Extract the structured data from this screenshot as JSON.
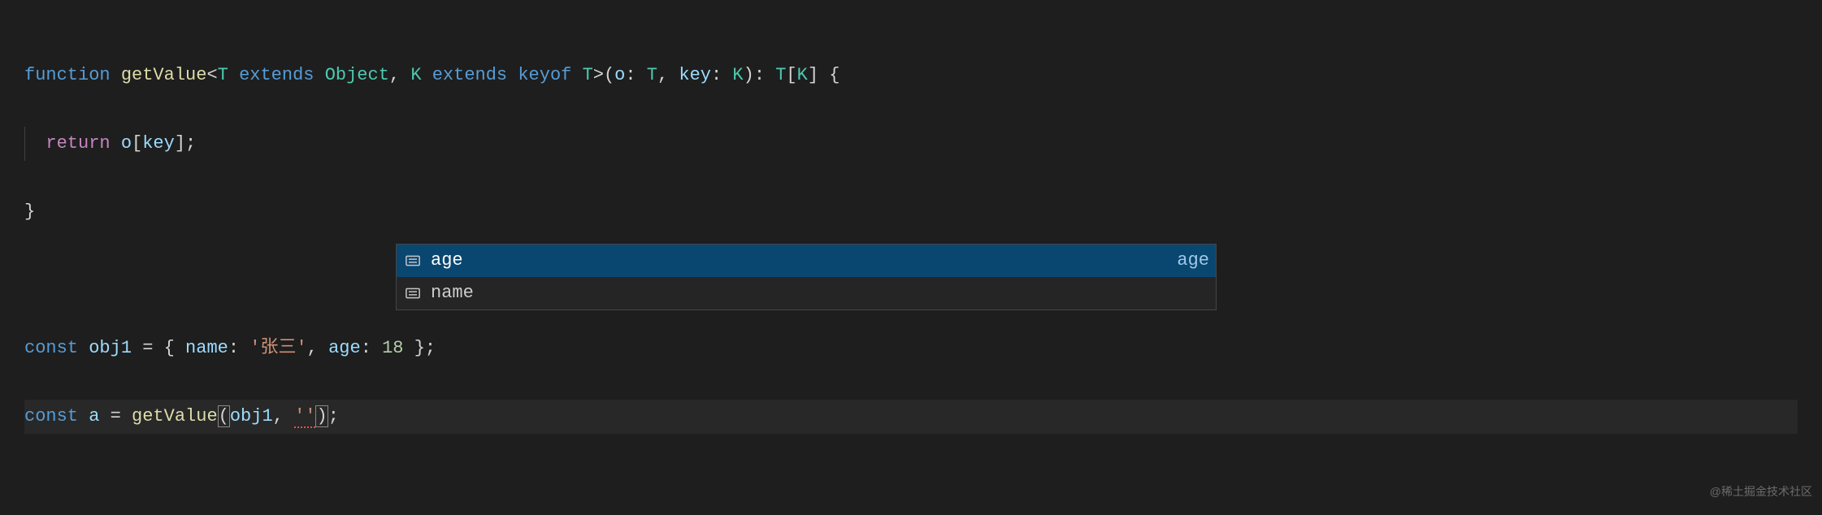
{
  "code": {
    "kw_function": "function",
    "fn_getValue": "getValue",
    "lt": "<",
    "type_T": "T",
    "kw_extends1": "extends",
    "type_Object": "Object",
    "comma1": ",",
    "type_K": "K",
    "kw_extends2": "extends",
    "kw_keyof": "keyof",
    "type_T2": "T",
    "gt": ">",
    "lparen1": "(",
    "param_o": "o",
    "colon1": ":",
    "type_T3": "T",
    "comma2": ",",
    "param_key": "key",
    "colon2": ":",
    "type_K2": "K",
    "rparen1": ")",
    "colon3": ":",
    "type_T4": "T",
    "lbracket": "[",
    "type_K3": "K",
    "rbracket": "]",
    "lbrace": "{",
    "kw_return": "return",
    "var_o": "o",
    "lbracket2": "[",
    "var_key": "key",
    "rbracket2": "]",
    "semi1": ";",
    "rbrace": "}",
    "kw_const1": "const",
    "var_obj1": "obj1",
    "eq1": "=",
    "lbrace2": "{",
    "prop_name": "name",
    "colon4": ":",
    "str_name": "'张三'",
    "comma3": ",",
    "prop_age": "age",
    "colon5": ":",
    "num_age": "18",
    "rbrace2": "}",
    "semi2": ";",
    "kw_const2": "const",
    "var_a": "a",
    "eq2": "=",
    "fn_getValue2": "getValue",
    "lparen2": "(",
    "arg_obj1": "obj1",
    "comma4": ",",
    "str_empty": "''",
    "rparen2": ")",
    "semi3": ";"
  },
  "suggest": {
    "items": [
      {
        "label": "age",
        "detail": "age",
        "selected": true
      },
      {
        "label": "name",
        "detail": "",
        "selected": false
      }
    ]
  },
  "watermark": "@稀土掘金技术社区"
}
